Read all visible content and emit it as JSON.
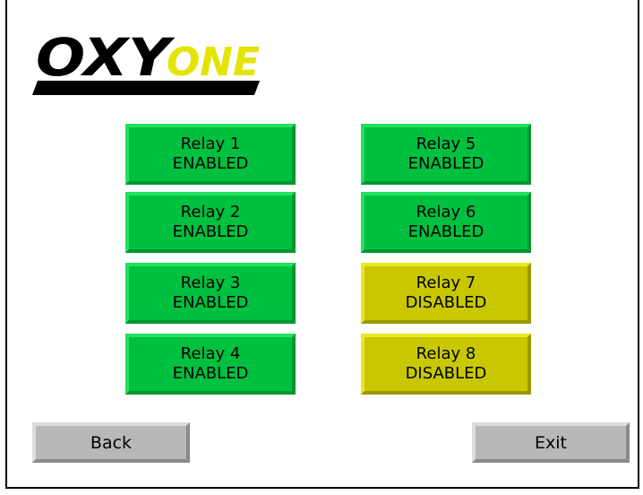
{
  "logo": {
    "part1": "OXY",
    "part2": "ONE",
    "color1": "#000000",
    "color2": "#e4e400"
  },
  "relays": [
    {
      "name": "Relay 1",
      "status": "ENABLED"
    },
    {
      "name": "Relay 2",
      "status": "ENABLED"
    },
    {
      "name": "Relay 3",
      "status": "ENABLED"
    },
    {
      "name": "Relay 4",
      "status": "ENABLED"
    },
    {
      "name": "Relay 5",
      "status": "ENABLED"
    },
    {
      "name": "Relay 6",
      "status": "ENABLED"
    },
    {
      "name": "Relay 7",
      "status": "DISABLED"
    },
    {
      "name": "Relay 8",
      "status": "DISABLED"
    }
  ],
  "colors": {
    "enabled": "#00c040",
    "disabled": "#c8c800",
    "nav": "#b8b8b8"
  },
  "nav": {
    "back_label": "Back",
    "exit_label": "Exit"
  }
}
